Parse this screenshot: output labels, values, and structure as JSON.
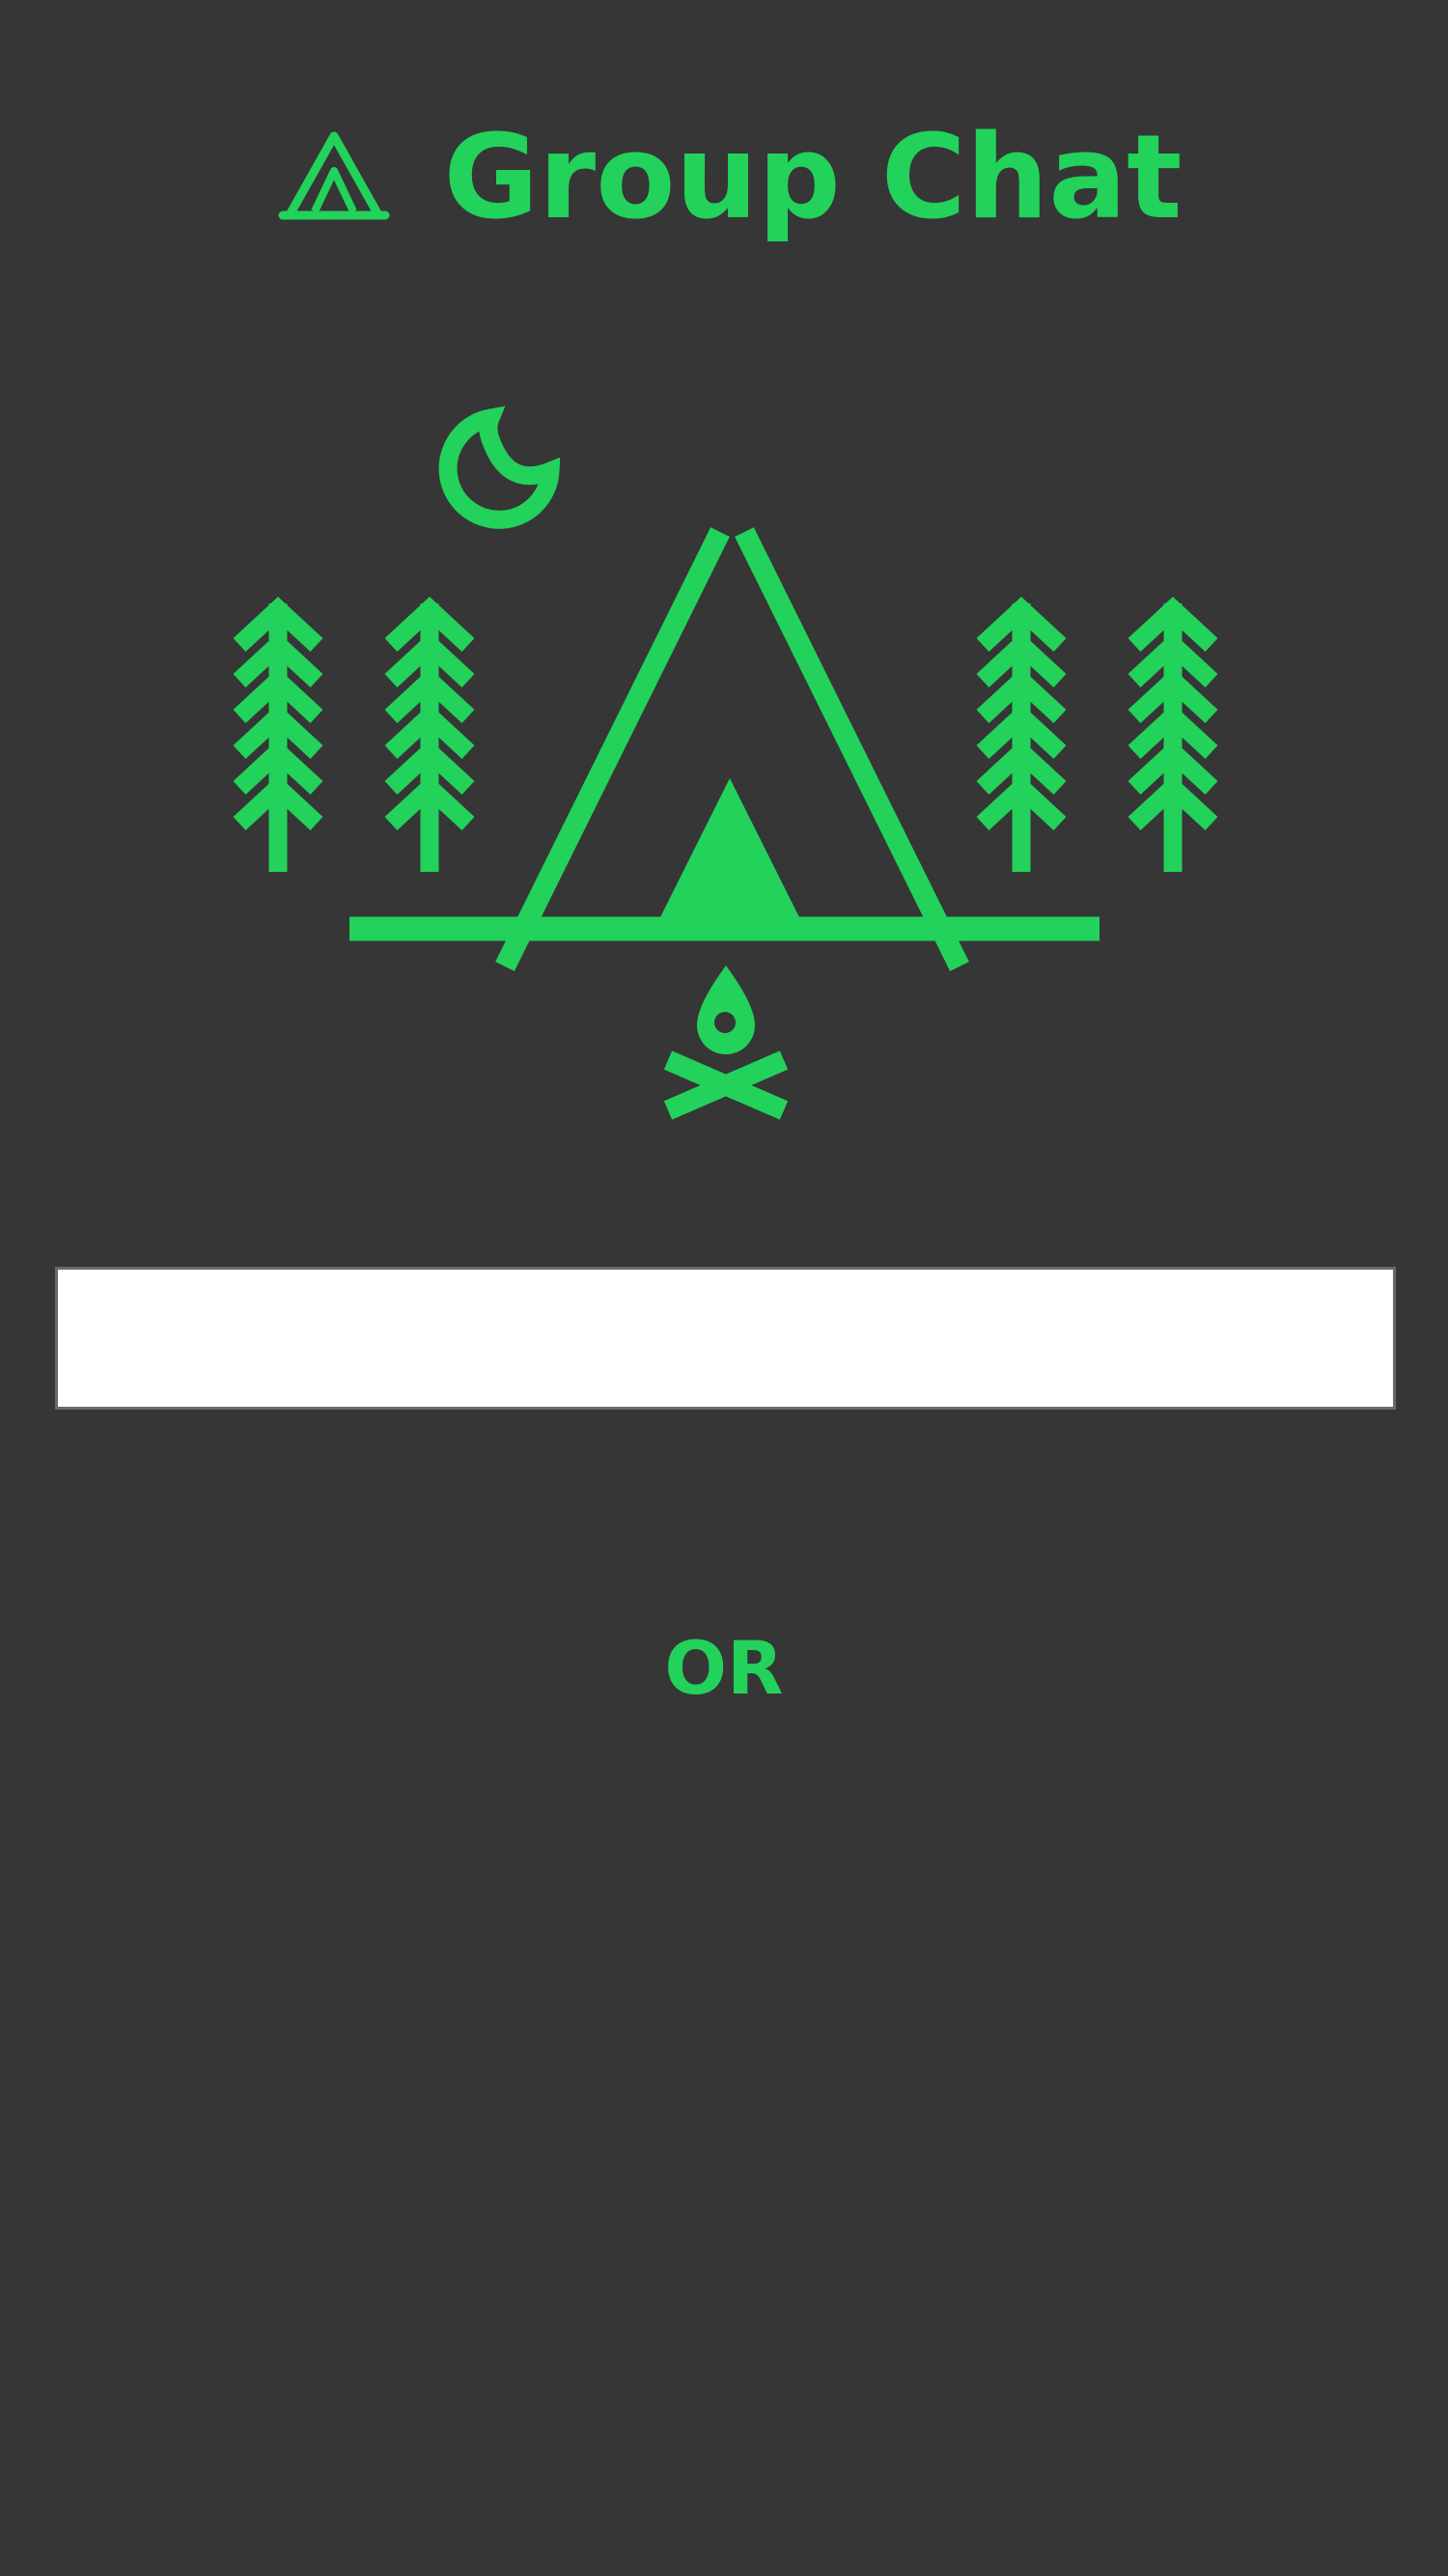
{
  "header": {
    "title": "Group Chat",
    "logo_icon": "tent-icon"
  },
  "scene": {
    "icons": [
      "moon-icon",
      "pine-tree-icon",
      "tent-icon",
      "campfire-icon"
    ]
  },
  "form": {
    "name_value": "",
    "name_placeholder": ""
  },
  "divider": {
    "label": "OR"
  },
  "colors": {
    "background": "#363636",
    "accent": "#22d25a",
    "input_background": "#ffffff",
    "input_border": "#6a6a6a"
  }
}
